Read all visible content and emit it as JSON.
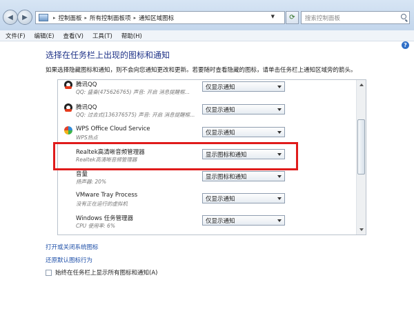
{
  "addressbar": {
    "breadcrumbs": [
      "控制面板",
      "所有控制面板项",
      "通知区域图标"
    ],
    "search_placeholder": "搜索控制面板"
  },
  "menu": [
    "文件(F)",
    "编辑(E)",
    "查看(V)",
    "工具(T)",
    "帮助(H)"
  ],
  "page": {
    "title": "选择在任务栏上出现的图标和通知",
    "description": "如果选择隐藏图标和通知，则不会向您通知更改和更新。若要随时查看隐藏的图标，请单击任务栏上通知区域旁的箭头。"
  },
  "rows": [
    {
      "name": "腾讯QQ",
      "sub": "QQ: 盛奋(475626765)  声音: 开启  消息提醒框...",
      "option": "仅显示通知",
      "icon": "qq-icon"
    },
    {
      "name": "腾讯QQ",
      "sub": "QQ: 过去式(136376575)  声音: 开启  消息提醒框...",
      "option": "仅显示通知",
      "icon": "qq-icon"
    },
    {
      "name": "WPS Office Cloud Service",
      "sub": "WPS热点",
      "option": "仅显示通知",
      "icon": "wps-icon"
    },
    {
      "name": "Realtek高清晰音频管理器",
      "sub": "Realtek高清晰音频管理器",
      "option": "显示图标和通知",
      "icon": "none"
    },
    {
      "name": "音量",
      "sub": "扬声器: 20%",
      "option": "显示图标和通知",
      "icon": "none"
    },
    {
      "name": "VMware Tray Process",
      "sub": "没有正在运行的虚拟机",
      "option": "仅显示通知",
      "icon": "none"
    },
    {
      "name": "Windows 任务管理器",
      "sub": "CPU 使用率: 6%",
      "option": "仅显示通知",
      "icon": "none"
    }
  ],
  "links": {
    "system_icons": "打开或关闭系统图标",
    "restore": "还原默认图标行为"
  },
  "checkbox": {
    "label": "始终在任务栏上显示所有图标和通知(A)",
    "checked": false
  },
  "colors": {
    "highlight": "#e01b1b",
    "title": "#1e3287",
    "link": "#1e4fa8"
  }
}
